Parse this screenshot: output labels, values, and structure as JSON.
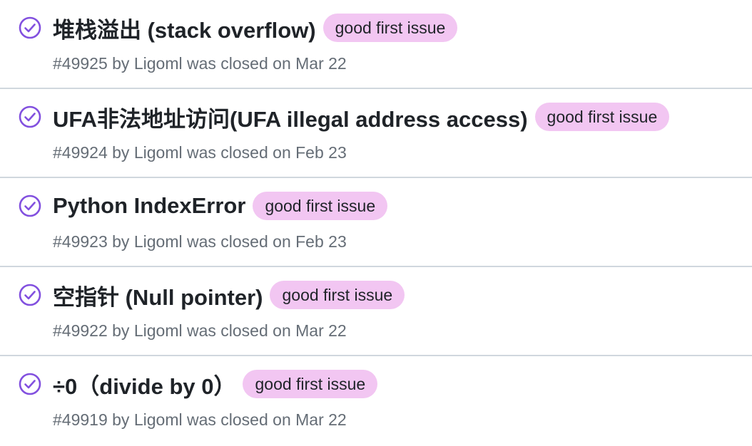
{
  "colors": {
    "closed_icon": "#8250df",
    "label_bg": "#f2c6f2",
    "title_text": "#1f2328",
    "meta_text": "#656d76",
    "divider": "#d0d7de"
  },
  "icons": {
    "status": "issue-closed-check-circle-icon"
  },
  "issues": [
    {
      "title": "堆栈溢出 (stack overflow)",
      "label": "good first issue",
      "number": "#49925",
      "by": "by",
      "author": "Ligoml",
      "status_text": "was closed on",
      "date": "Mar 22"
    },
    {
      "title": "UFA非法地址访问(UFA illegal address access)",
      "label": "good first issue",
      "number": "#49924",
      "by": "by",
      "author": "Ligoml",
      "status_text": "was closed on",
      "date": "Feb 23"
    },
    {
      "title": "Python IndexError",
      "label": "good first issue",
      "number": "#49923",
      "by": "by",
      "author": "Ligoml",
      "status_text": "was closed on",
      "date": "Feb 23"
    },
    {
      "title": "空指针 (Null pointer)",
      "label": "good first issue",
      "number": "#49922",
      "by": "by",
      "author": "Ligoml",
      "status_text": "was closed on",
      "date": "Mar 22"
    },
    {
      "title": "÷0（divide by 0）",
      "label": "good first issue",
      "number": "#49919",
      "by": "by",
      "author": "Ligoml",
      "status_text": "was closed on",
      "date": "Mar 22"
    }
  ]
}
